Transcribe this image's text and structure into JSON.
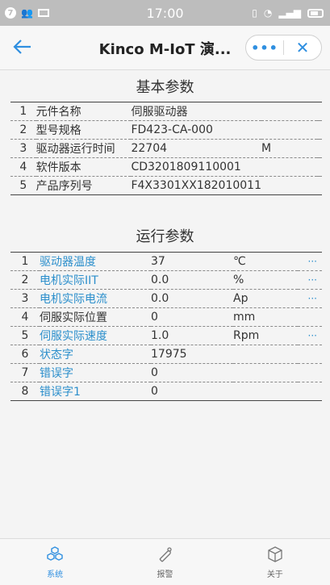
{
  "status": {
    "time": "17:00"
  },
  "header": {
    "title": "Kinco M-IoT 演...",
    "more_label": "•••",
    "close_label": "✕"
  },
  "basic": {
    "title": "基本参数",
    "rows": [
      {
        "idx": "1",
        "name": "元件名称",
        "value": "伺服驱动器",
        "unit": ""
      },
      {
        "idx": "2",
        "name": "型号规格",
        "value": "FD423-CA-000",
        "unit": ""
      },
      {
        "idx": "3",
        "name": "驱动器运行时间",
        "value": "22704",
        "unit": "M"
      },
      {
        "idx": "4",
        "name": "软件版本",
        "value": "CD3201809110001",
        "unit": ""
      },
      {
        "idx": "5",
        "name": "产品序列号",
        "value": "F4X3301XX182010011",
        "unit": ""
      }
    ]
  },
  "run": {
    "title": "运行参数",
    "rows": [
      {
        "idx": "1",
        "name": "驱动器温度",
        "value": "37",
        "unit": "℃",
        "more": "···"
      },
      {
        "idx": "2",
        "name": "电机实际IIT",
        "value": "0.0",
        "unit": "%",
        "more": "···"
      },
      {
        "idx": "3",
        "name": "电机实际电流",
        "value": "0.0",
        "unit": "Ap",
        "more": "···"
      },
      {
        "idx": "4",
        "name": "伺服实际位置",
        "value": "0",
        "unit": "mm",
        "more": ""
      },
      {
        "idx": "5",
        "name": "伺服实际速度",
        "value": "1.0",
        "unit": "Rpm",
        "more": "···"
      },
      {
        "idx": "6",
        "name": "状态字",
        "value": "17975",
        "unit": "",
        "more": ""
      },
      {
        "idx": "7",
        "name": "错误字",
        "value": "0",
        "unit": "",
        "more": ""
      },
      {
        "idx": "8",
        "name": "错误字1",
        "value": "0",
        "unit": "",
        "more": ""
      }
    ]
  },
  "tabs": [
    {
      "label": "系统",
      "icon": "cubes-icon"
    },
    {
      "label": "报警",
      "icon": "alarm-icon"
    },
    {
      "label": "关于",
      "icon": "box-icon"
    }
  ]
}
